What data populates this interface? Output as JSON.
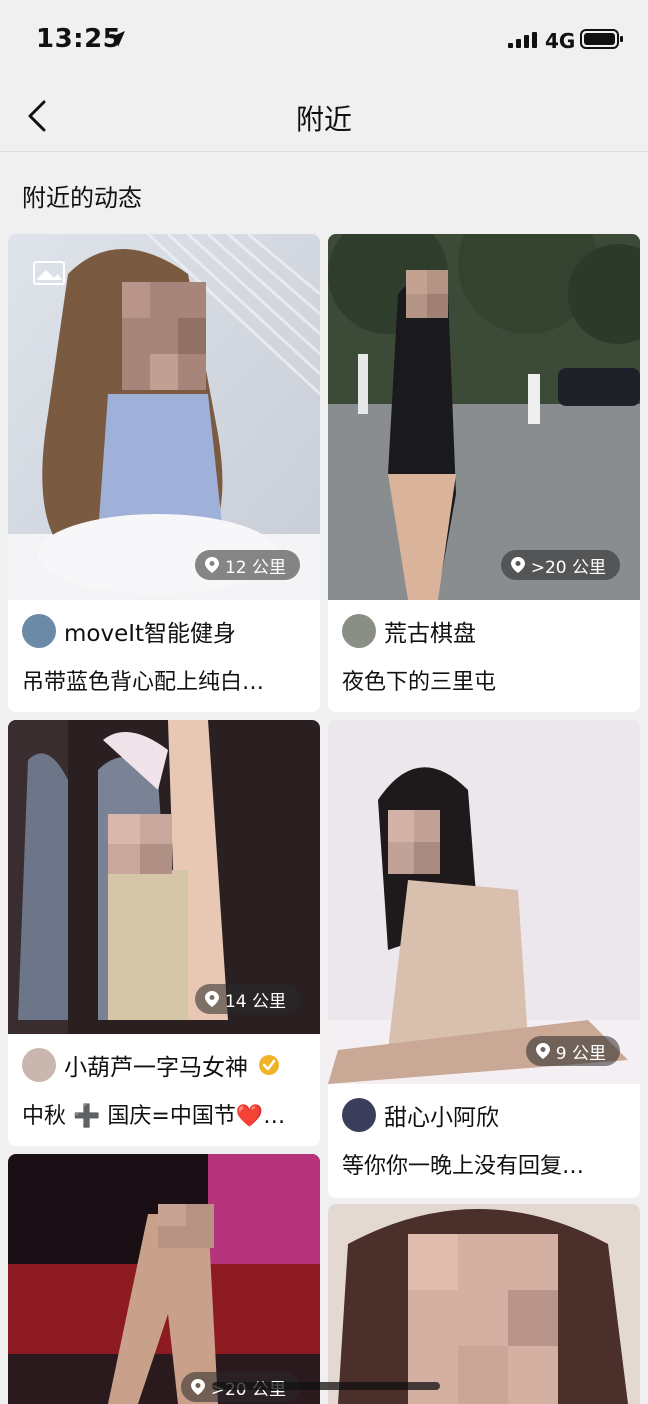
{
  "status_bar": {
    "time": "13:25",
    "network": "4G"
  },
  "nav": {
    "title": "附近"
  },
  "section_title": "附近的动态",
  "colors": {
    "background": "#f0f0f0",
    "card": "#ffffff",
    "verified": "#f0b429",
    "distance_badge": "rgba(40,40,40,0.55)"
  },
  "cards": [
    {
      "distance": "12 公里",
      "author": "moveIt智能健身",
      "caption": "吊带蓝色背心配上纯白…"
    },
    {
      "distance": ">20 公里",
      "author": "荒古棋盘",
      "caption": "夜色下的三里屯"
    },
    {
      "distance": "14 公里",
      "author": "小葫芦一字马女神",
      "caption": "中秋 ➕ 国庆=中国节❤️…",
      "verified": true
    },
    {
      "distance": "9 公里",
      "author": "甜心小阿欣",
      "caption": "等你你一晚上没有回复…"
    },
    {
      "distance": ">20 公里"
    },
    {}
  ]
}
